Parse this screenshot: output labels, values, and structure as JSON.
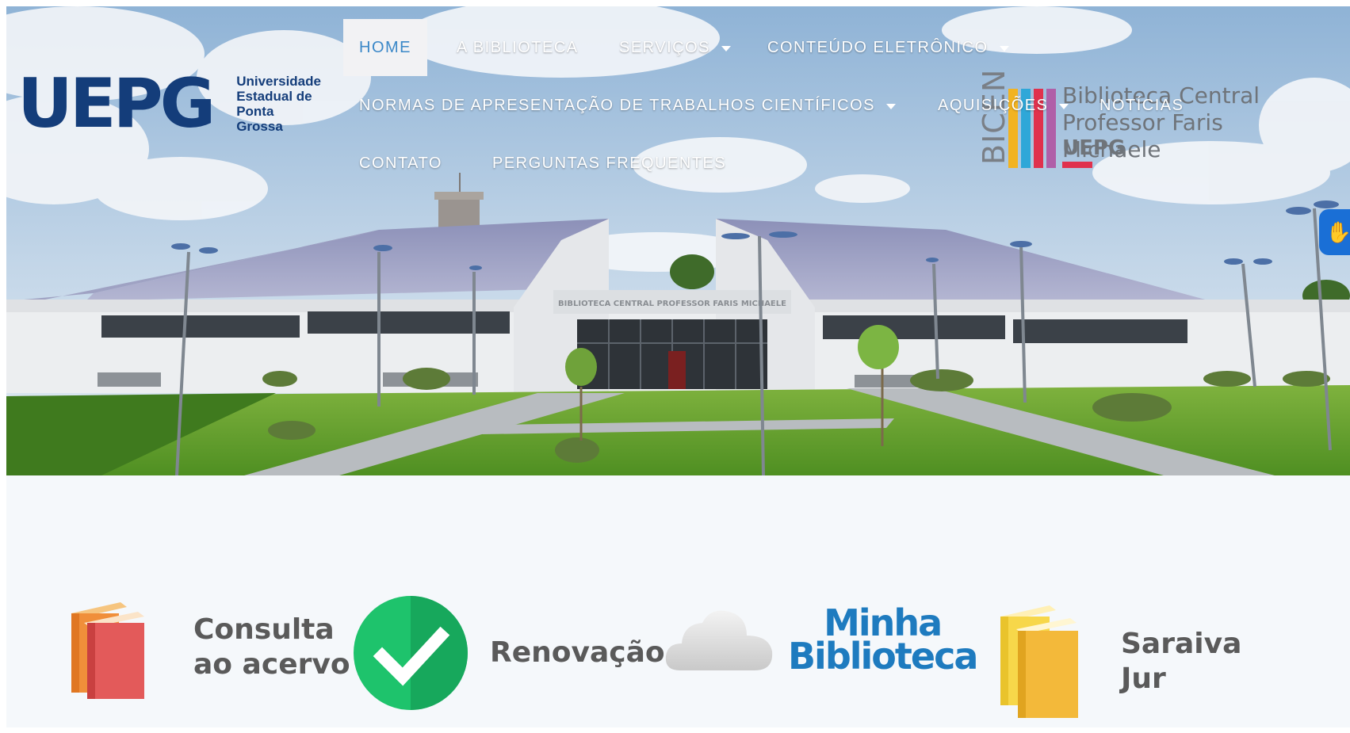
{
  "header": {
    "university": {
      "mark": "UEPG",
      "name_lines": [
        "Universidade",
        "Estadual de",
        "Ponta Grossa"
      ]
    },
    "nav": {
      "items": [
        {
          "label": "HOME",
          "active": true,
          "has_dropdown": false
        },
        {
          "label": "A BIBLIOTECA",
          "active": false,
          "has_dropdown": false
        },
        {
          "label": "SERVIÇOS",
          "active": false,
          "has_dropdown": true
        },
        {
          "label": "CONTEÚDO ELETRÔNICO",
          "active": false,
          "has_dropdown": true
        },
        {
          "label": "NORMAS DE APRESENTAÇÃO DE TRABALHOS CIENTÍFICOS",
          "active": false,
          "has_dropdown": true
        },
        {
          "label": "AQUISIÇÕES",
          "active": false,
          "has_dropdown": true
        },
        {
          "label": "NOTÍCIAS",
          "active": false,
          "has_dropdown": false
        },
        {
          "label": "CONTATO",
          "active": false,
          "has_dropdown": false
        },
        {
          "label": "PERGUNTAS FREQUENTES",
          "active": false,
          "has_dropdown": false
        }
      ]
    },
    "bicen": {
      "vertical": "BICEN",
      "line1": "Biblioteca Central",
      "line2": "Professor Faris Michaele",
      "line3": "UEPG",
      "bar_colors": [
        "#f2b321",
        "#2fa7d8",
        "#e0314d",
        "#b05fa8"
      ]
    },
    "building_sign": "BIBLIOTECA CENTRAL PROFESSOR FARIS MICHAELE",
    "accessibility_icon": "sign-language-hands-icon"
  },
  "quick_links": [
    {
      "label_lines": [
        "Consulta",
        "ao acervo"
      ],
      "icon": "books-icon"
    },
    {
      "label_lines": [
        "Renovação"
      ],
      "icon": "check-circle-icon"
    },
    {
      "label_lines": [
        "Minha",
        "Biblioteca"
      ],
      "icon": "cloud-icon"
    },
    {
      "label_lines": [
        "Saraiva",
        "Jur"
      ],
      "icon": "yellow-books-icon"
    }
  ],
  "colors": {
    "nav_active_text": "#3b88c8",
    "uepg_blue": "#143d7a",
    "check_green": "#1ec36c",
    "minha_biblioteca_blue": "#1e7bbf"
  }
}
